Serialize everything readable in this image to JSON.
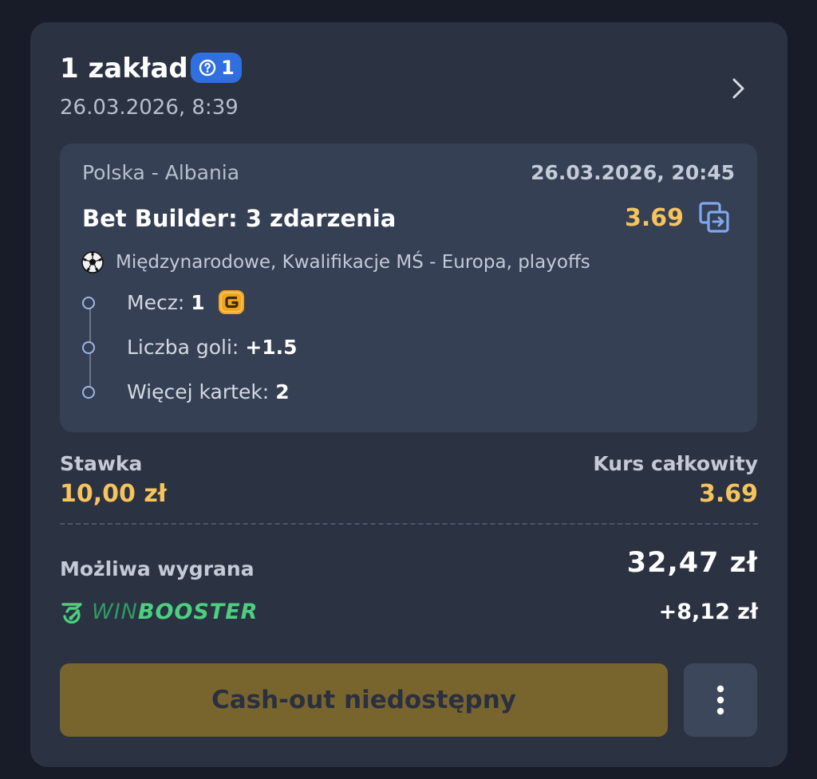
{
  "header": {
    "title": "1 zakład",
    "pending_count": "1",
    "placed_date": "26.03.2026, 8:39"
  },
  "event": {
    "name": "Polska - Albania",
    "date": "26.03.2026, 20:45",
    "builder_title": "Bet Builder: 3 zdarzenia",
    "odds": "3.69",
    "league": "Międzynarodowe, Kwalifikacje MŚ - Europa, playoffs",
    "selections": [
      {
        "label": "Mecz:",
        "value": "1",
        "badge": "G"
      },
      {
        "label": "Liczba goli:",
        "value": "+1.5"
      },
      {
        "label": "Więcej kartek:",
        "value": "2"
      }
    ]
  },
  "summary": {
    "stake_label": "Stawka",
    "stake_value": "10,00 zł",
    "total_odds_label": "Kurs całkowity",
    "total_odds_value": "3.69",
    "possible_win_label": "Możliwa wygrana",
    "possible_win_value": "32,47 zł",
    "booster_brand_win": "WIN",
    "booster_brand_boost": "BOOSTER",
    "booster_value": "+8,12 zł"
  },
  "actions": {
    "cashout_label": "Cash-out niedostępny"
  },
  "colors": {
    "background": "#171c28",
    "card": "#2b3343",
    "event_box": "#354055",
    "accent_gold": "#f7c45c",
    "badge_blue": "#2f6fe0",
    "booster_green": "#4ccf7f",
    "cashout_disabled": "#78652d"
  },
  "icons": {
    "pending": "clock-question-icon",
    "chevron": "chevron-right-icon",
    "copy": "copy-bet-icon",
    "sport": "soccer-ball-icon",
    "boost": "g-boost-icon",
    "booster": "winbooster-logo-icon",
    "more": "more-vertical-icon"
  }
}
